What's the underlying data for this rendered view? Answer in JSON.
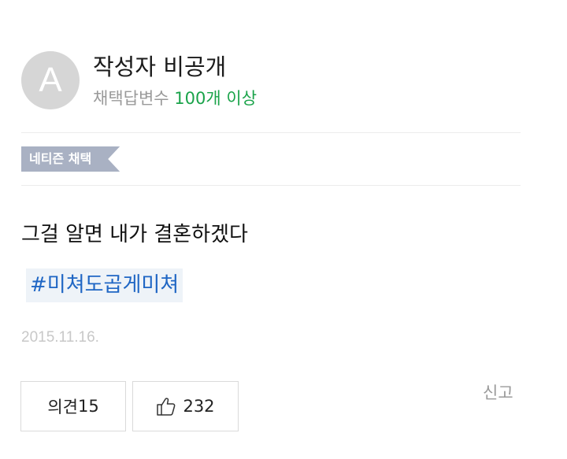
{
  "author": {
    "avatar_letter": "A",
    "name": "작성자 비공개",
    "meta_prefix": "채택답변수",
    "meta_highlight": "100개 이상"
  },
  "badge": {
    "label": "네티즌 채택"
  },
  "answer": {
    "text": "그걸 알면 내가 결혼하겠다"
  },
  "tag": {
    "label": "#미쳐도곱게미쳐"
  },
  "date": "2015.11.16.",
  "actions": {
    "opinion_label": "의견",
    "opinion_count": "15",
    "like_count": "232",
    "report_label": "신고"
  },
  "colors": {
    "highlight": "#1aa34a",
    "badge_bg": "#a9b1c3",
    "tag_text": "#1f66c4",
    "tag_bg": "#eef3f8"
  },
  "icons": [
    "thumbs-up-icon"
  ]
}
